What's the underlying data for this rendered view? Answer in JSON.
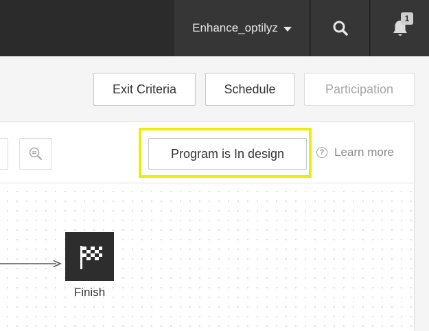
{
  "topbar": {
    "user_name": "Enhance_optilyz",
    "notification_count": "1"
  },
  "header_buttons": {
    "exit_criteria": "Exit Criteria",
    "schedule": "Schedule",
    "participation": "Participation"
  },
  "toolbar": {
    "status_label": "Program is In design",
    "learn_more": "Learn more",
    "help_glyph": "?"
  },
  "canvas": {
    "finish_label": "Finish"
  },
  "colors": {
    "topbar_bg": "#2b2b2b",
    "highlight": "#f0ec0a",
    "node_bg": "#2d2d2d"
  },
  "icons": [
    "caret-down-icon",
    "search-icon",
    "bell-icon",
    "zoom-out-icon",
    "help-icon",
    "checkered-flag-icon",
    "arrow-right-icon"
  ]
}
